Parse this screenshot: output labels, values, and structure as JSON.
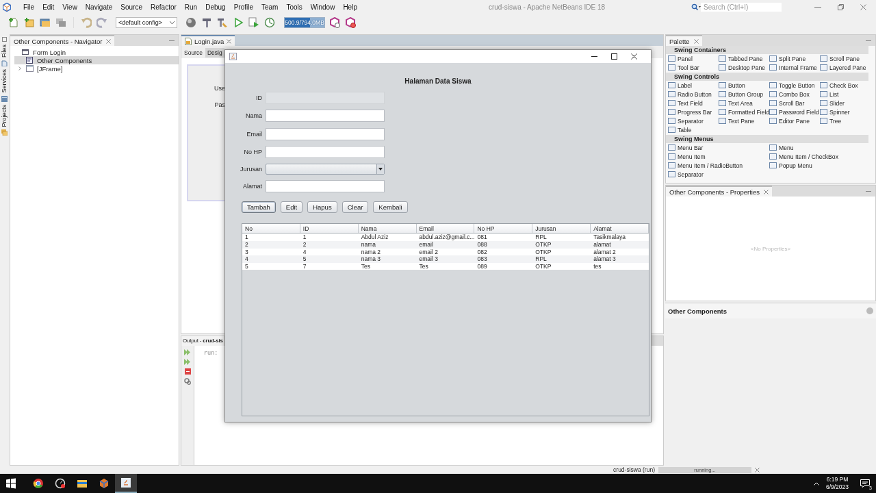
{
  "ide": {
    "title": "crud-siswa - Apache NetBeans IDE 18",
    "menu": [
      "File",
      "Edit",
      "View",
      "Navigate",
      "Source",
      "Refactor",
      "Run",
      "Debug",
      "Profile",
      "Team",
      "Tools",
      "Window",
      "Help"
    ],
    "search": {
      "placeholder": "Search (Ctrl+I)"
    },
    "config": "<default config>",
    "memory": {
      "reading": "500.9/794.0MB",
      "level": 0.63
    }
  },
  "side_tabs": [
    "Files",
    "Services",
    "Projects"
  ],
  "navigator": {
    "title": "Other Components - Navigator",
    "tree": [
      {
        "label": "Form Login",
        "selected": false,
        "children": [
          {
            "label": "Other Components",
            "selected": true
          },
          {
            "label": "[JFrame]",
            "selected": false,
            "expanded": false
          }
        ]
      }
    ]
  },
  "editor": {
    "tab": "Login.java",
    "views": [
      {
        "label": "Source",
        "selected": false
      },
      {
        "label": "Desig",
        "selected": true
      }
    ],
    "design_labels": [
      "Use",
      "Pas"
    ]
  },
  "output": {
    "title": "Output - **crud-sis**",
    "text": "run:"
  },
  "palette": {
    "title": "Palette",
    "sections": [
      {
        "title": "Swing Containers",
        "kind": "grid",
        "items": [
          "Panel",
          "Tabbed Pane",
          "Split Pane",
          "Scroll Pane",
          "Tool Bar",
          "Desktop Pane",
          "Internal Frame",
          "Layered Pane"
        ]
      },
      {
        "title": "Swing Controls",
        "kind": "grid",
        "items": [
          "Label",
          "Button",
          "Toggle Button",
          "Check Box",
          "Radio Button",
          "Button Group",
          "Combo Box",
          "List",
          "Text Field",
          "Text Area",
          "Scroll Bar",
          "Slider",
          "Progress Bar",
          "Formatted Field",
          "Password Field",
          "Spinner",
          "Separator",
          "Text Pane",
          "Editor Pane",
          "Tree",
          "Table"
        ]
      },
      {
        "title": "Swing Menus",
        "kind": "wide",
        "items": [
          "Menu Bar",
          "Menu",
          "Menu Item",
          "Menu Item / CheckBox",
          "Menu Item / RadioButton",
          "Popup Menu",
          "Separator"
        ]
      }
    ]
  },
  "properties": {
    "title": "Other Components - Properties",
    "empty": "<No Properties>",
    "footer": "Other Components"
  },
  "status": {
    "task": "crud-siswa (run)",
    "progress": "running...",
    "level": 1
  },
  "taskbar": {
    "time": "6:19 PM",
    "date": "6/9/2023",
    "notifications": "3"
  },
  "app": {
    "heading": "Halaman Data Siswa",
    "fields": [
      {
        "label": "ID",
        "kind": "text",
        "disabled": true
      },
      {
        "label": "Nama",
        "kind": "text",
        "disabled": false
      },
      {
        "label": "Email",
        "kind": "text",
        "disabled": false
      },
      {
        "label": "No HP",
        "kind": "text",
        "disabled": false
      },
      {
        "label": "Jurusan",
        "kind": "combo",
        "disabled": false
      },
      {
        "label": "Alamat",
        "kind": "text",
        "disabled": false
      }
    ],
    "buttons": [
      {
        "label": "Tambah",
        "focused": true
      },
      {
        "label": "Edit",
        "focused": false
      },
      {
        "label": "Hapus",
        "focused": false
      },
      {
        "label": "Clear",
        "focused": false
      },
      {
        "label": "Kembali",
        "focused": false
      }
    ],
    "table": {
      "columns": [
        "No",
        "ID",
        "Nama",
        "Email",
        "No HP",
        "Jurusan",
        "Alamat"
      ],
      "rows": [
        [
          "1",
          "1",
          "Abdul Aziz",
          "abdul.aziz@gmail.c...",
          "081",
          "RPL",
          "Tasikmalaya"
        ],
        [
          "2",
          "2",
          "nama",
          "email",
          "088",
          "OTKP",
          "alamat"
        ],
        [
          "3",
          "4",
          "nama 2",
          "email 2",
          "082",
          "OTKP",
          "alamat 2"
        ],
        [
          "4",
          "5",
          "nama 3",
          "email 3",
          "083",
          "RPL",
          "alamat 3"
        ],
        [
          "5",
          "7",
          "Tes",
          "Tes",
          "089",
          "OTKP",
          "tes"
        ]
      ]
    }
  }
}
